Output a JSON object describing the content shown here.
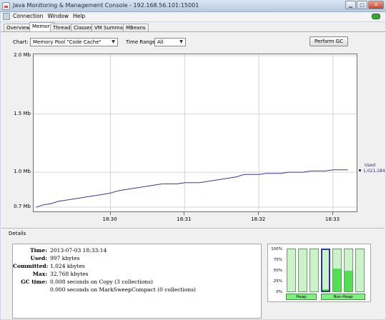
{
  "window": {
    "title": "Java Monitoring & Management Console - 192.168.56.101:15001"
  },
  "menu": {
    "items": [
      "Connection",
      "Window",
      "Help"
    ]
  },
  "tabs": [
    "Overview",
    "Memory",
    "Threads",
    "Classes",
    "VM Summary",
    "MBeans"
  ],
  "controls": {
    "chart_label": "Chart:",
    "chart_value": "Memory Pool \"Code Cache\"",
    "time_range_label": "Time Range:",
    "time_range_value": "All",
    "gc_button": "Perform GC"
  },
  "chart_data": {
    "type": "line",
    "y_tick_labels": [
      "2.0 Mb",
      "1.5 Mb",
      "1.0 Mb",
      "0.7 Mb"
    ],
    "y_ticks": [
      2.0,
      1.5,
      1.0,
      0.7
    ],
    "x_tick_labels": [
      "18:30",
      "18:31",
      "18:32",
      "18:33"
    ],
    "ylim": [
      0.7,
      2.0
    ],
    "series": [
      {
        "name": "Used",
        "x": [
          "18:29:00",
          "18:29:06",
          "18:29:12",
          "18:29:18",
          "18:29:24",
          "18:29:30",
          "18:29:36",
          "18:29:42",
          "18:29:48",
          "18:29:54",
          "18:30:00",
          "18:30:06",
          "18:30:12",
          "18:30:18",
          "18:30:24",
          "18:30:30",
          "18:30:36",
          "18:30:42",
          "18:30:48",
          "18:30:54",
          "18:31:00",
          "18:31:06",
          "18:31:12",
          "18:31:18",
          "18:31:24",
          "18:31:30",
          "18:31:36",
          "18:31:42",
          "18:31:48",
          "18:31:54",
          "18:32:00",
          "18:32:06",
          "18:32:12",
          "18:32:18",
          "18:32:24",
          "18:32:30",
          "18:32:36",
          "18:32:42",
          "18:32:48",
          "18:32:54",
          "18:33:00",
          "18:33:06",
          "18:33:12"
        ],
        "values": [
          0.7,
          0.72,
          0.73,
          0.75,
          0.76,
          0.77,
          0.78,
          0.79,
          0.8,
          0.81,
          0.82,
          0.84,
          0.85,
          0.86,
          0.87,
          0.88,
          0.89,
          0.9,
          0.9,
          0.9,
          0.91,
          0.91,
          0.91,
          0.92,
          0.93,
          0.94,
          0.95,
          0.96,
          0.98,
          0.98,
          0.98,
          0.99,
          0.99,
          0.99,
          1.0,
          1.0,
          1.0,
          1.01,
          1.01,
          1.01,
          1.02,
          1.02,
          1.02
        ]
      }
    ],
    "legend": {
      "series": "Used",
      "value": "1,021,184"
    },
    "grid": true,
    "line_color": "#3a3a8a"
  },
  "details": {
    "title": "Details",
    "rows": [
      {
        "key": "Time:",
        "value": "2013-07-03 18:33:14"
      },
      {
        "key": "Used:",
        "value": "997 kbytes"
      },
      {
        "key": "Committed:",
        "value": "1,024 kbytes"
      },
      {
        "key": "Max:",
        "value": "32,768 kbytes"
      },
      {
        "key": "GC time:",
        "value": "0.008  seconds on Copy (3 collections)"
      },
      {
        "key": "",
        "value": "0.000  seconds on MarkSweepCompact (0 collections)"
      }
    ]
  },
  "pool_bars": {
    "pct_labels": [
      "100%",
      "75%",
      "50%",
      "25%",
      "0%"
    ],
    "levels": [
      0,
      0,
      0,
      0.03,
      0.55,
      0.5,
      0
    ],
    "selected_index": 3,
    "groups": [
      "Heap",
      "Non-Heap"
    ]
  }
}
